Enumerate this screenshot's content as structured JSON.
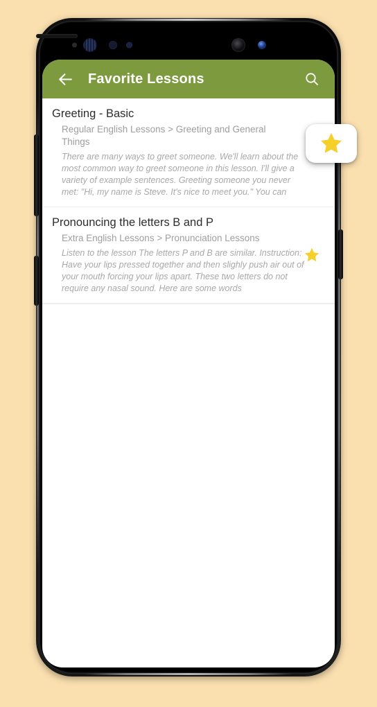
{
  "background_color": "#fadfaf",
  "device": {
    "name": "android-phone-mockup",
    "frame_color": "#111111",
    "sensors": [
      "proximity-sensor-dot",
      "iris-scanner",
      "light-sensor-a",
      "light-sensor-b",
      "earpiece-speaker",
      "front-camera",
      "status-led"
    ],
    "buttons": [
      "volume-rocker-button",
      "bixby-button",
      "power-button"
    ]
  },
  "app_bar": {
    "title": "Favorite Lessons",
    "background_color": "#7d9b3e",
    "text_color": "#ffffff",
    "back_icon": "arrow-left-icon",
    "search_icon": "search-icon"
  },
  "star_color": "#f5cf2a",
  "lessons": [
    {
      "title": "Greeting - Basic",
      "subtitle": "Regular English Lessons > Greeting and General Things",
      "description": "There are many ways to greet someone. We'll learn about the most common way to greet someone in this lesson. I'll give a variety of example sentences. Greeting someone you never met: \"Hi, my name is Steve. It's nice to meet you.\" You can",
      "favorited": true,
      "star_icon": "star-filled-icon",
      "star_highlighted": true
    },
    {
      "title": "Pronouncing the letters B and P",
      "subtitle": "Extra English Lessons > Pronunciation Lessons",
      "description": "Listen to the lesson The letters P and B are similar. Instruction: Have your lips pressed together and then slighly push air out of your mouth forcing your lips apart. These two letters do not require any nasal sound. Here are some words",
      "favorited": true,
      "star_icon": "star-filled-icon",
      "star_highlighted": false
    }
  ]
}
